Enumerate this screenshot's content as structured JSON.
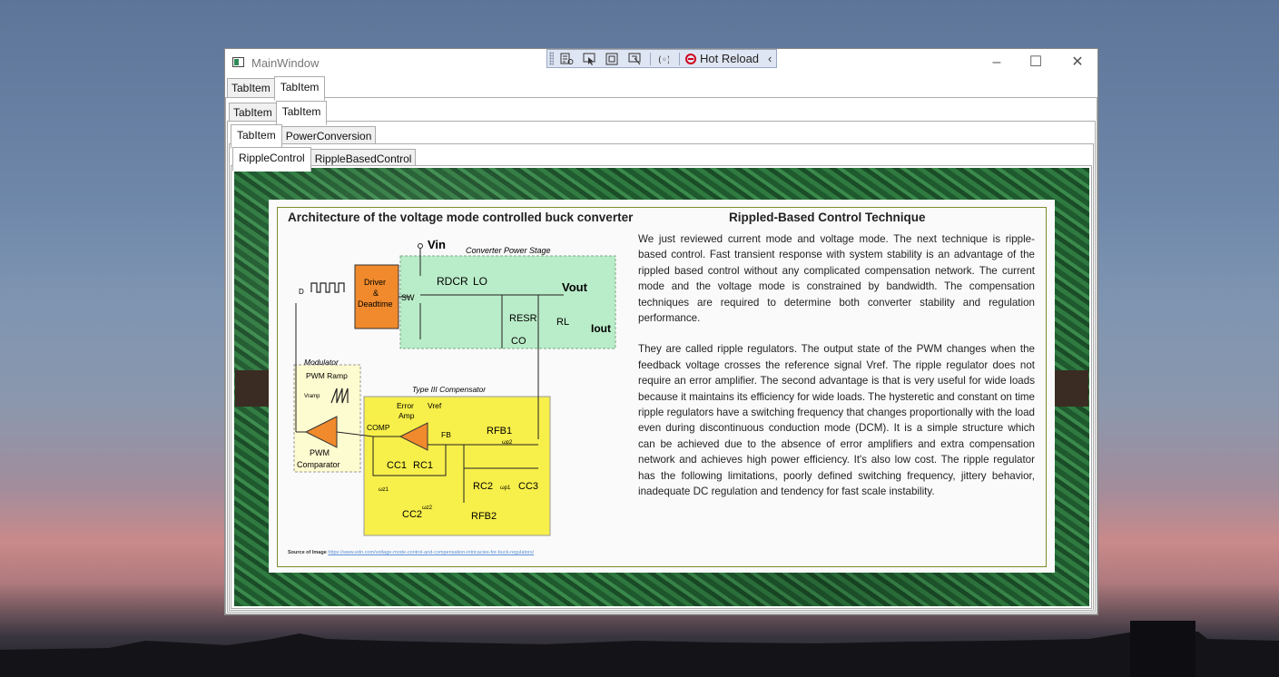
{
  "window": {
    "title": "MainWindow"
  },
  "toolbar": {
    "hot_reload_label": "Hot Reload"
  },
  "tabs": {
    "level1": [
      "TabItem",
      "TabItem"
    ],
    "level2": [
      "TabItem",
      "TabItem"
    ],
    "level3": [
      "TabItem",
      "PowerConversion"
    ],
    "level4": [
      "RippleControl",
      "RippleBasedControl"
    ]
  },
  "slide": {
    "left_title": "Architecture of the voltage mode controlled buck converter",
    "right_title": "Rippled-Based Control Technique",
    "paragraph1": "We just reviewed current mode and voltage mode. The next technique is ripple-based control.  Fast transient response with system stability is an advantage of the rippled based control without any complicated compensation network. The current mode and the voltage mode is constrained by bandwidth. The compensation techniques are required to determine both converter stability and regulation performance.",
    "paragraph2": "They are called ripple regulators.  The output state of the PWM changes when the feedback voltage crosses the reference signal Vref.  The ripple regulator does not require an error amplifier. The second advantage is that is very useful for wide loads because it maintains its efficiency for wide loads. The hysteretic and constant on time ripple regulators have a switching frequency that changes proportionally with the load even during discontinuous conduction mode (DCM).   It is a simple structure which can be achieved due to the absence of error amplifiers and extra compensation network and achieves high power efficiency. It's also low cost.  The ripple regulator has the following limitations, poorly defined switching frequency, jittery behavior, inadequate DC regulation and tendency for fast scale instability.",
    "source_label": "Source of Image",
    "source_link": "https://www.edn.com/voltage-mode-control-and-compensation-intricacies-for-buck-regulators/"
  },
  "diagram": {
    "vin": "Vin",
    "power_stage": "Converter Power Stage",
    "driver": [
      "Driver",
      "&",
      "Deadtime"
    ],
    "d": "D",
    "sw": "SW",
    "rdcr": "RDCR",
    "lo": "LO",
    "vout": "Vout",
    "resr": "RESR",
    "co": "CO",
    "rl": "RL",
    "iout": "Iout",
    "modulator": "Modulator",
    "pwm_ramp": "PWM Ramp",
    "vramp": "Vramp",
    "pwm_comparator": [
      "PWM",
      "Comparator"
    ],
    "compensator": "Type III Compensator",
    "error_amp": [
      "Error",
      "Amp"
    ],
    "vref": "Vref",
    "comp": "COMP",
    "fb": "FB",
    "rfb1": "RFB1",
    "cc1": "CC1",
    "rc1": "RC1",
    "rc2": "RC2",
    "cc3": "CC3",
    "cc2": "CC2",
    "rfb2": "RFB2",
    "wp2": "ωp2",
    "wz1": "ωz1",
    "wz2": "ωz2",
    "wp1": "ωp1"
  },
  "colors": {
    "driver_fill": "#f08a2c",
    "power_stage_fill": "#b9ecc8",
    "compensator_fill": "#f7ef4a",
    "modulator_fill": "#fdfbd0",
    "slide_border": "#7d8a2a"
  }
}
